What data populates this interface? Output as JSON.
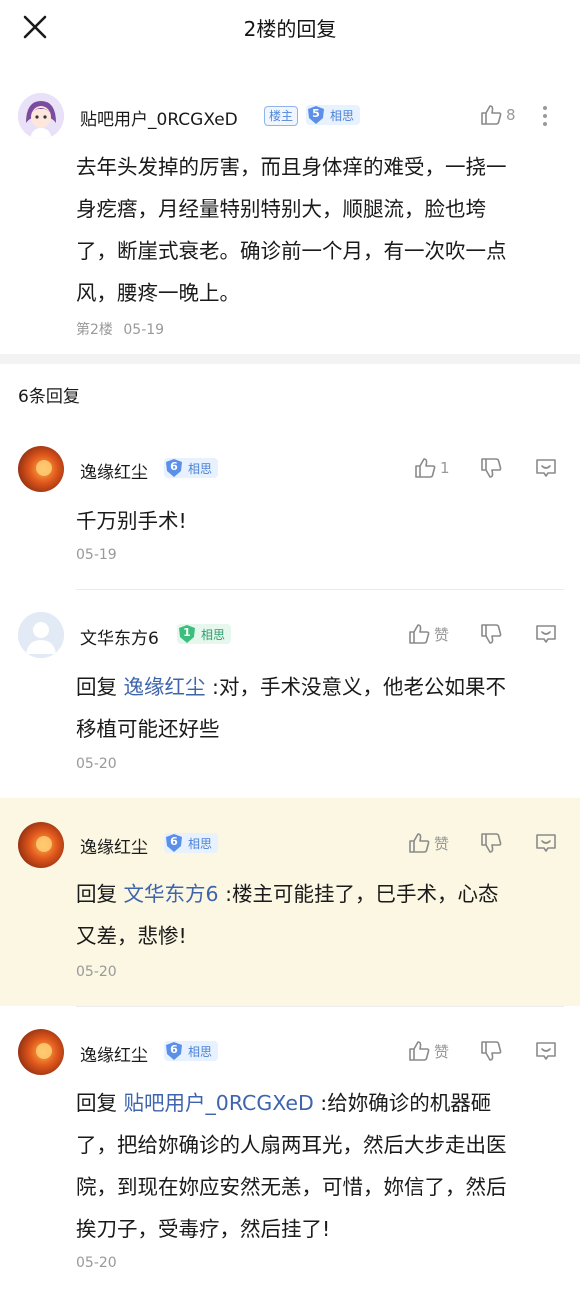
{
  "header": {
    "title": "2楼的回复"
  },
  "main_post": {
    "username": "贴吧用户_0RCGXeD",
    "owner_badge": "楼主",
    "level": "5",
    "level_tag": "相思",
    "likes": "8",
    "content_lines": [
      "去年头发掉的厉害，而且身体痒的难受，一挠一",
      "身疙瘩，月经量特别特别大，顺腿流，脸也垮",
      "了，断崖式衰老。确诊前一个月，有一次吹一点",
      "风，腰疼一晚上。"
    ],
    "floor": "第2楼",
    "date": "05-19"
  },
  "reply_count": "6条回复",
  "replies": [
    {
      "username": "逸缘红尘",
      "level": "6",
      "level_tag": "相思",
      "like_label": "1",
      "reply_prefix": "",
      "reply_to": "",
      "lines": [
        "千万别手术!"
      ],
      "date": "05-19"
    },
    {
      "username": "文华东方6",
      "level": "1",
      "level_tag": "相思",
      "like_label": "赞",
      "reply_prefix": "回复",
      "reply_to": "逸缘红尘",
      "lines": [
        " :对，手术没意义，他老公如果不",
        "移植可能还好些"
      ],
      "date": "05-20"
    },
    {
      "username": "逸缘红尘",
      "level": "6",
      "level_tag": "相思",
      "like_label": "赞",
      "reply_prefix": "回复",
      "reply_to": "文华东方6",
      "lines": [
        " :楼主可能挂了，巳手术，心态",
        "又差，悲惨!"
      ],
      "date": "05-20"
    },
    {
      "username": "逸缘红尘",
      "level": "6",
      "level_tag": "相思",
      "like_label": "赞",
      "reply_prefix": "回复",
      "reply_to": "贴吧用户_0RCGXeD",
      "lines": [
        " :给妳确诊的机器砸",
        "了，把给妳确诊的人扇两耳光，然后大步走出医",
        "院，到现在妳应安然无恙，可惜，妳信了，然后",
        "挨刀子，受毒疗，然后挂了!"
      ],
      "date": "05-20"
    }
  ],
  "colors": {
    "accent_link": "#3e64ae",
    "level_blue": "#5b8fe8",
    "level_green": "#3cbf7d",
    "highlight": "#fbf7e3"
  }
}
